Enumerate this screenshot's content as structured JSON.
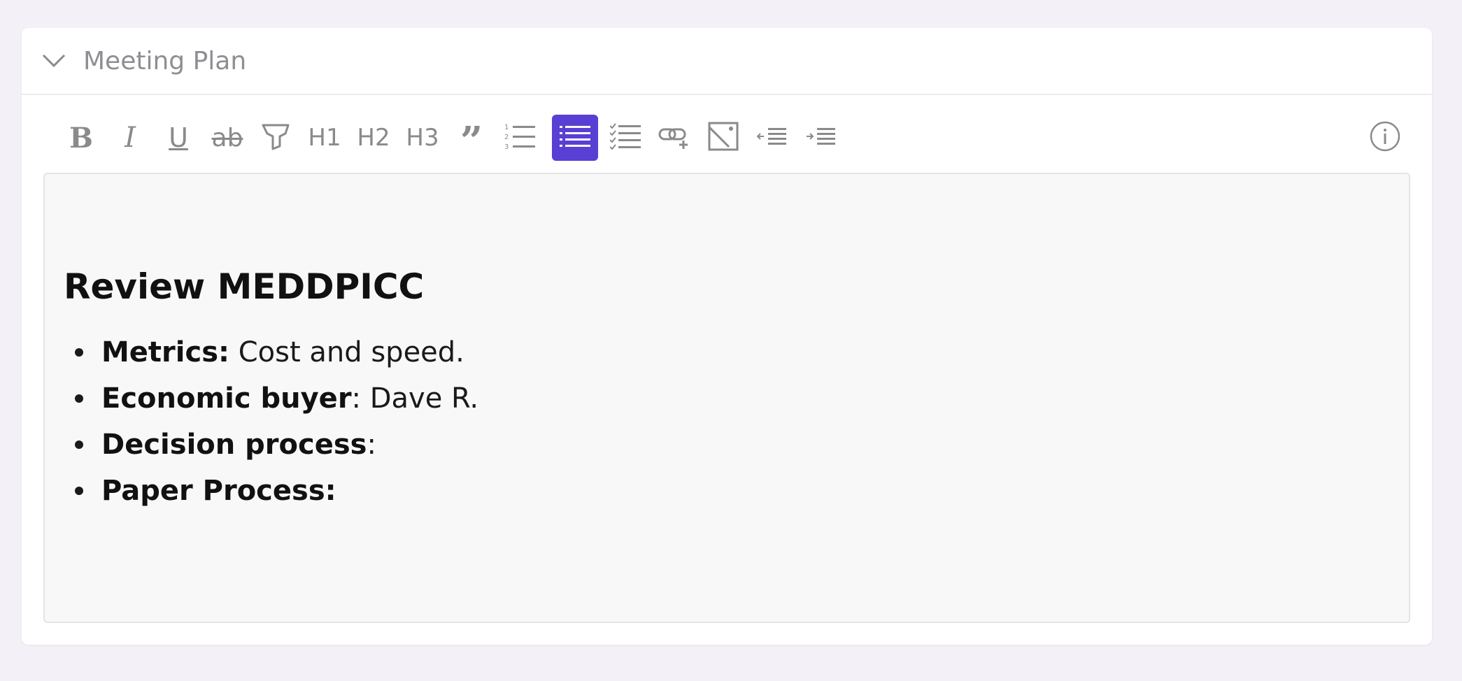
{
  "section": {
    "title": "Meeting Plan",
    "collapse_icon": "chevron-down-icon"
  },
  "toolbar": {
    "buttons": [
      {
        "name": "bold",
        "label": "B",
        "icon": "bold-icon"
      },
      {
        "name": "italic",
        "label": "I",
        "icon": "italic-icon"
      },
      {
        "name": "underline",
        "label": "U",
        "icon": "underline-icon"
      },
      {
        "name": "strikethrough",
        "label": "ab",
        "icon": "strikethrough-icon"
      },
      {
        "name": "highlight",
        "icon": "highlighter-icon"
      },
      {
        "name": "heading-1",
        "label": "H1"
      },
      {
        "name": "heading-2",
        "label": "H2"
      },
      {
        "name": "heading-3",
        "label": "H3"
      },
      {
        "name": "blockquote",
        "label": "”",
        "icon": "quote-icon"
      },
      {
        "name": "ordered-list",
        "icon": "ordered-list-icon"
      },
      {
        "name": "bullet-list",
        "icon": "bullet-list-icon",
        "active": true
      },
      {
        "name": "checklist",
        "icon": "checklist-icon"
      },
      {
        "name": "link",
        "icon": "add-link-icon"
      },
      {
        "name": "image",
        "icon": "image-icon"
      },
      {
        "name": "outdent",
        "icon": "outdent-icon"
      },
      {
        "name": "indent",
        "icon": "indent-icon"
      },
      {
        "name": "info",
        "icon": "info-icon"
      }
    ],
    "accent_color": "#5a3fd4"
  },
  "editor": {
    "heading": "Review MEDDPICC",
    "items": [
      {
        "label": "Metrics:",
        "value": " Cost and speed."
      },
      {
        "label": "Economic buyer",
        "value": ": Dave R."
      },
      {
        "label": "Decision process",
        "value": ":"
      },
      {
        "label": "Paper Process:",
        "value": ""
      }
    ]
  }
}
